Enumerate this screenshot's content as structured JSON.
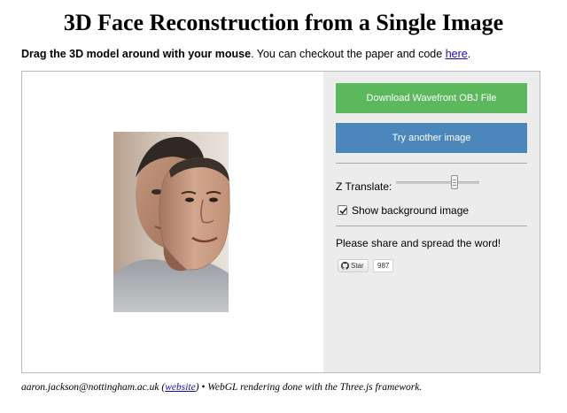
{
  "header": {
    "title": "3D Face Reconstruction from a Single Image"
  },
  "intro": {
    "bold_text": "Drag the 3D model around with your mouse",
    "text": ". You can checkout the paper and code ",
    "link_text": "here",
    "end_text": "."
  },
  "controls": {
    "download_label": "Download Wavefront OBJ File",
    "try_another_label": "Try another image",
    "z_translate_label": "Z Translate:",
    "z_translate_value": 0.7,
    "show_background_label": "Show background image",
    "show_background_checked": true,
    "share_text": "Please share and spread the word!",
    "github_star_label": "Star",
    "github_star_count": "987"
  },
  "footer": {
    "email": "aaron.jackson@nottingham.ac.uk",
    "website_open": " (",
    "website_link": "website",
    "website_close": ")",
    "rest": " • WebGL rendering done with the Three.js framework."
  },
  "colors": {
    "download_button": "#5cb85c",
    "try_another_button": "#4c87bb",
    "panel_background": "#ececec",
    "link": "#1a0dab"
  },
  "icons": {
    "github": "github-octocat-icon",
    "checkbox": "checkmark-icon"
  }
}
